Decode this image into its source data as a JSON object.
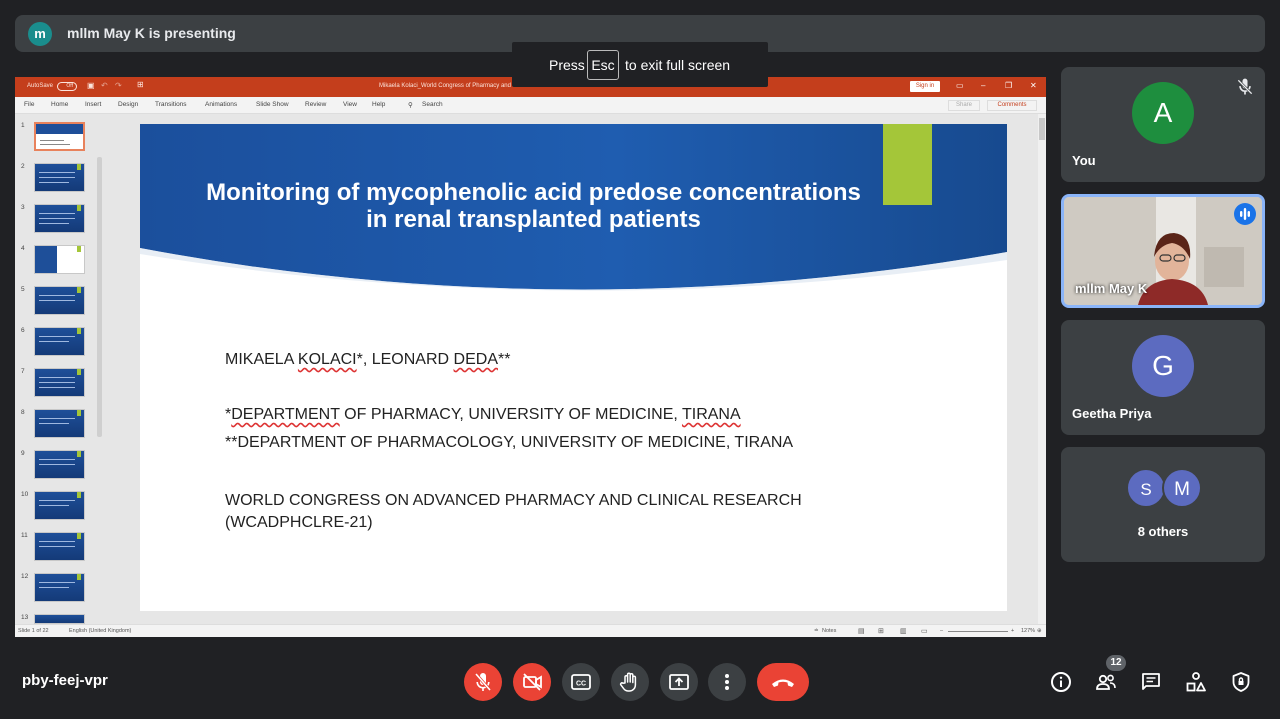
{
  "presenter_bar": {
    "avatar_letter": "m",
    "text": "mllm May K is presenting"
  },
  "fullscreen_toast": {
    "press": "Press",
    "key": "Esc",
    "rest": "to exit full screen"
  },
  "ppt": {
    "autosave": "AutoSave",
    "autosave_state": "Off",
    "window_title": "Mikaela Kolaci_World Congress of Pharmacy and Clinical Research  -  Protected View  -  Saved to this PC",
    "sign_in": "Sign in",
    "ribbon_tabs": [
      "File",
      "Home",
      "Insert",
      "Design",
      "Transitions",
      "Animations",
      "Slide Show",
      "Review",
      "View",
      "Help"
    ],
    "search": "Search",
    "share": "Share",
    "comments": "Comments",
    "thumbnail_numbers": [
      "1",
      "2",
      "3",
      "4",
      "5",
      "6",
      "7",
      "8",
      "9",
      "10",
      "11",
      "12",
      "13"
    ],
    "status": {
      "slide": "Slide 1 of 22",
      "language": "English (United Kingdom)",
      "notes": "Notes",
      "zoom": "127%"
    }
  },
  "slide": {
    "title": "Monitoring of mycophenolic acid predose concentrations in renal transplanted patients",
    "authors_pre": "MIKAELA ",
    "authors_kolaci": "KOLACI",
    "authors_mid": "*, LEONARD ",
    "authors_deda": "DEDA",
    "authors_post": "**",
    "dept1_pre": "*",
    "dept1_word": "DEPARTMENT",
    "dept1_mid": " OF PHARMACY, UNIVERSITY OF MEDICINE, ",
    "dept1_tirana": "TIRANA",
    "dept2": "**DEPARTMENT OF PHARMACOLOGY, UNIVERSITY OF MEDICINE, TIRANA",
    "congress_line1": "WORLD CONGRESS ON ADVANCED PHARMACY AND CLINICAL RESEARCH",
    "congress_line2": "(WCADPHCLRE-21)"
  },
  "participants": {
    "you": {
      "letter": "A",
      "name": "You",
      "color": "#1e8e3e"
    },
    "presenter": {
      "name": "mllm May K"
    },
    "geetha": {
      "letter": "G",
      "name": "Geetha Priya",
      "color": "#5c6bc0"
    },
    "others": {
      "letter_s": "S",
      "letter_m": "M",
      "label": "8 others"
    }
  },
  "bottom_bar": {
    "meeting_code": "pby-feej-vpr",
    "people_count": "12"
  },
  "colors": {
    "meet_bg": "#202124",
    "tile_bg": "#3c4043",
    "red": "#ea4335",
    "ppt_orange": "#c43e1c",
    "slide_blue": "#1b4f9c",
    "slide_green": "#a4c639"
  }
}
